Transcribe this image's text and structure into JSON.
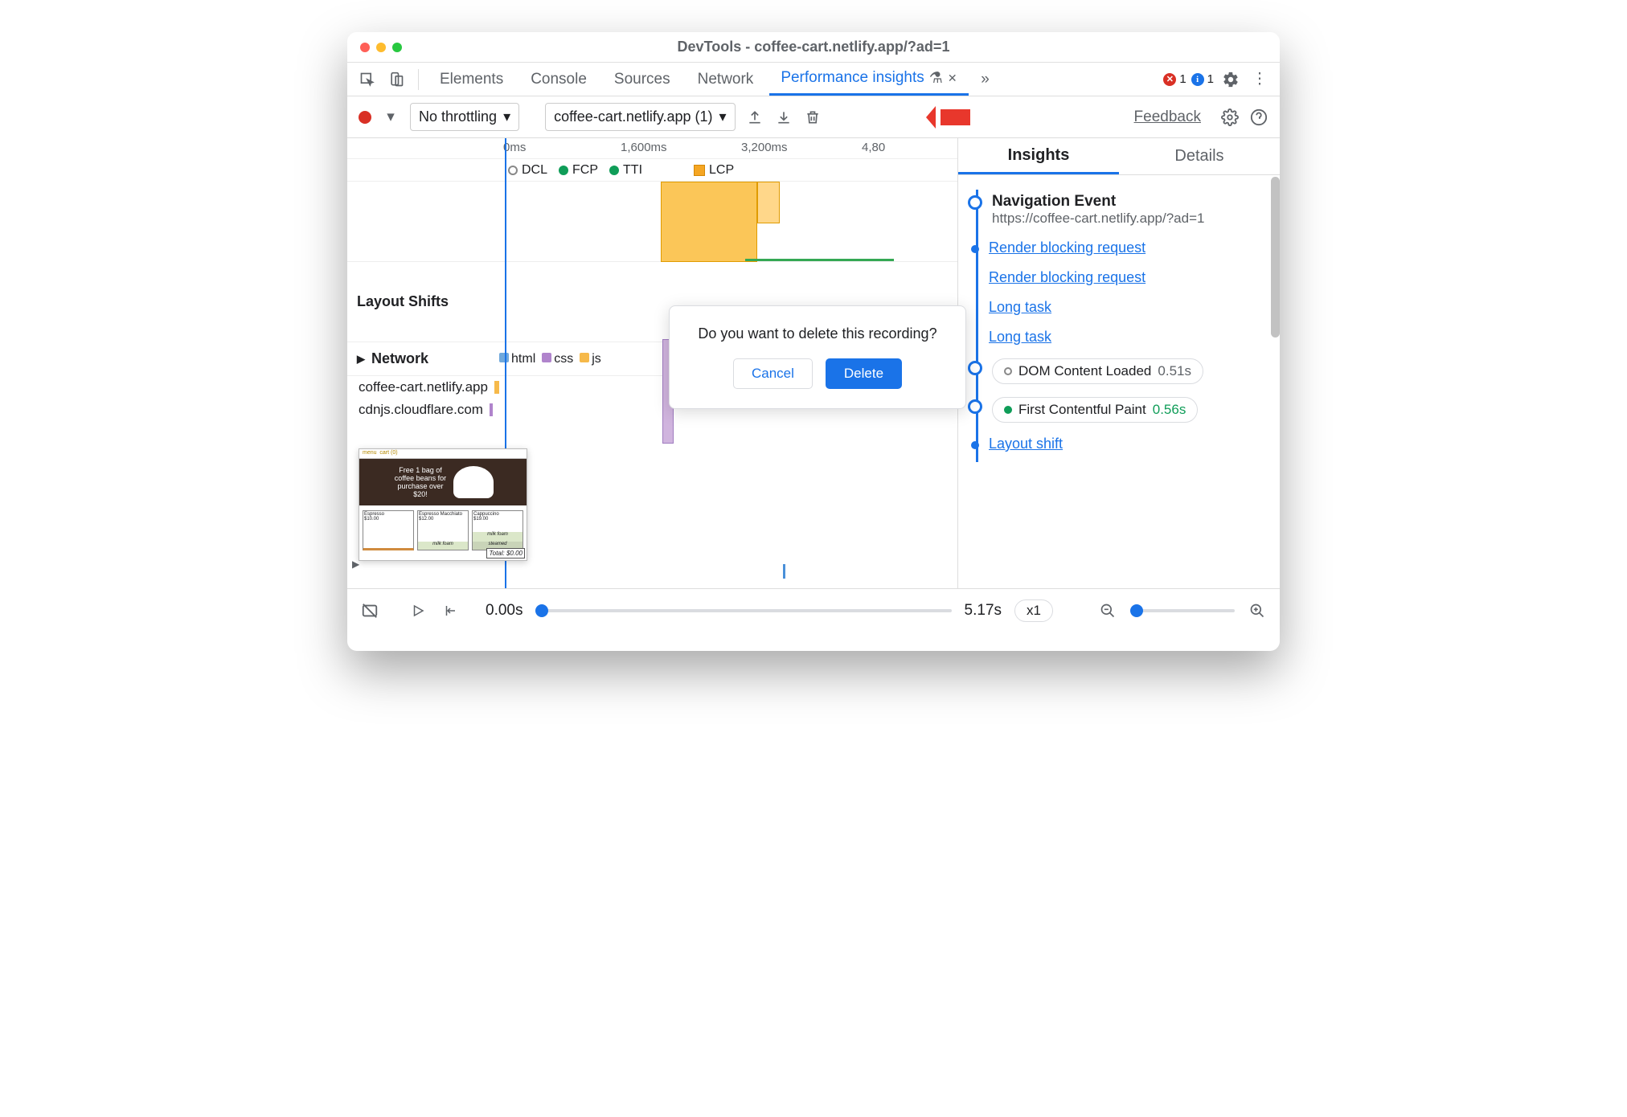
{
  "title": "DevTools - coffee-cart.netlify.app/?ad=1",
  "tabs": [
    "Elements",
    "Console",
    "Sources",
    "Network"
  ],
  "active_tab": "Performance insights",
  "badges": {
    "errors": "1",
    "info": "1"
  },
  "toolbar": {
    "throttle": "No throttling",
    "recording": "coffee-cart.netlify.app (1)",
    "feedback": "Feedback"
  },
  "ruler": [
    "0ms",
    "1,600ms",
    "3,200ms",
    "4,80"
  ],
  "markers": {
    "dcl": "DCL",
    "fcp": "FCP",
    "tti": "TTI",
    "lcp": "LCP"
  },
  "sections": {
    "layout_shifts": "Layout Shifts",
    "network": "Network"
  },
  "legend": {
    "html": "html",
    "css": "css",
    "js": "js"
  },
  "network_rows": [
    "coffee-cart.netlify.app",
    "cdnjs.cloudflare.com"
  ],
  "dialog": {
    "msg": "Do you want to delete this recording?",
    "cancel": "Cancel",
    "delete": "Delete"
  },
  "right_tabs": {
    "insights": "Insights",
    "details": "Details"
  },
  "insights": {
    "nav_title": "Navigation Event",
    "nav_url": "https://coffee-cart.netlify.app/?ad=1",
    "rb1": "Render blocking request",
    "rb2": "Render blocking request",
    "lt1": "Long task",
    "lt2": "Long task",
    "dcl_label": "DOM Content Loaded",
    "dcl_time": "0.51s",
    "fcp_label": "First Contentful Paint",
    "fcp_time": "0.56s",
    "ls": "Layout shift"
  },
  "playbar": {
    "start": "0.00s",
    "end": "5.17s",
    "speed": "x1"
  },
  "thumb": {
    "promo": "Free 1 bag of coffee beans for purchase over $20!",
    "total": "Total: $0.00"
  }
}
